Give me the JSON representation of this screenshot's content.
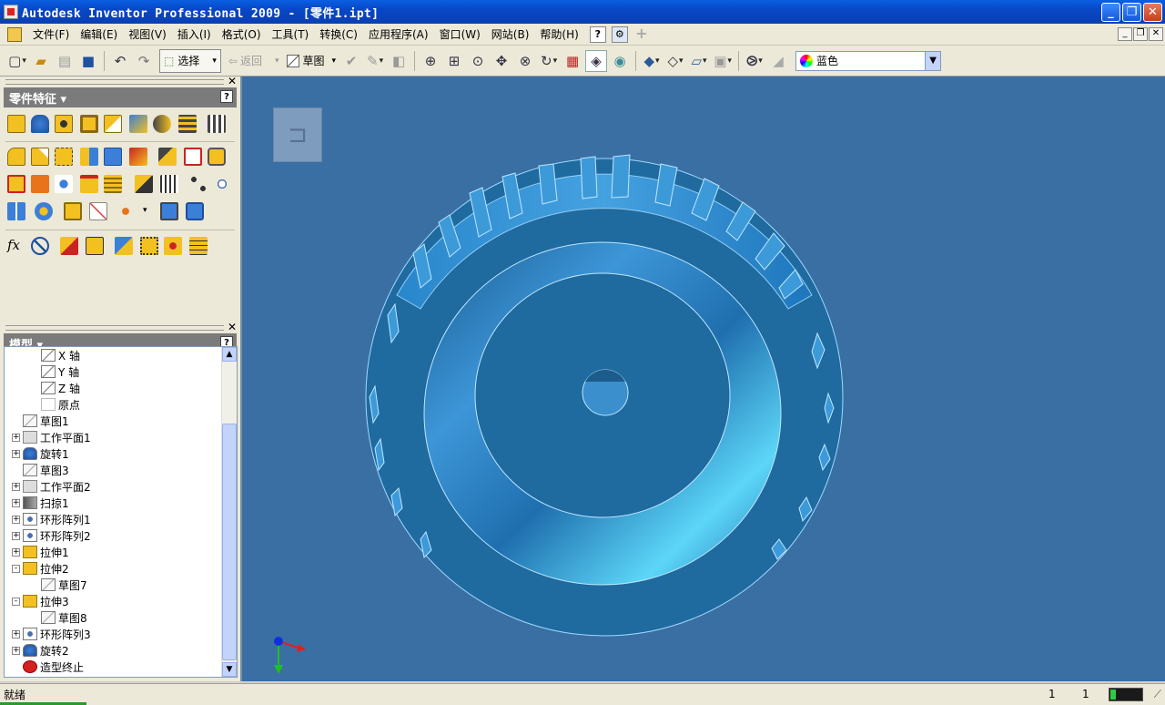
{
  "window": {
    "title": "Autodesk Inventor Professional 2009 - [零件1.ipt]",
    "minimize": "_",
    "restore": "❐",
    "close": "✕"
  },
  "menu": {
    "items": [
      "文件(F)",
      "编辑(E)",
      "视图(V)",
      "插入(I)",
      "格式(O)",
      "工具(T)",
      "转换(C)",
      "应用程序(A)",
      "窗口(W)",
      "网站(B)",
      "帮助(H)"
    ],
    "help_icon": "?"
  },
  "toolbar": {
    "select_label": "选择",
    "back_label": "返回",
    "sketch_label": "草图",
    "color_value": "蓝色"
  },
  "feature_panel": {
    "title": "零件特征 ▾",
    "help": "?",
    "close": "✕",
    "fx_label": "fx"
  },
  "model_panel": {
    "title": "模型 ▾",
    "help": "?",
    "close": "✕",
    "tree": [
      {
        "label": "X 轴",
        "icon": "axis",
        "indent": 2,
        "expander": ""
      },
      {
        "label": "Y 轴",
        "icon": "axis",
        "indent": 2,
        "expander": ""
      },
      {
        "label": "Z 轴",
        "icon": "axis",
        "indent": 2,
        "expander": ""
      },
      {
        "label": "原点",
        "icon": "point",
        "indent": 2,
        "expander": ""
      },
      {
        "label": "草图1",
        "icon": "sketch",
        "indent": 1,
        "expander": ""
      },
      {
        "label": "工作平面1",
        "icon": "plane",
        "indent": 1,
        "expander": "+"
      },
      {
        "label": "旋转1",
        "icon": "revolve",
        "indent": 1,
        "expander": "+"
      },
      {
        "label": "草图3",
        "icon": "sketch",
        "indent": 1,
        "expander": ""
      },
      {
        "label": "工作平面2",
        "icon": "plane",
        "indent": 1,
        "expander": "+"
      },
      {
        "label": "扫掠1",
        "icon": "sweep",
        "indent": 1,
        "expander": "+"
      },
      {
        "label": "环形阵列1",
        "icon": "pattern",
        "indent": 1,
        "expander": "+"
      },
      {
        "label": "环形阵列2",
        "icon": "pattern",
        "indent": 1,
        "expander": "+"
      },
      {
        "label": "拉伸1",
        "icon": "extrude",
        "indent": 1,
        "expander": "+"
      },
      {
        "label": "拉伸2",
        "icon": "extrude",
        "indent": 1,
        "expander": "-"
      },
      {
        "label": "草图7",
        "icon": "sketch",
        "indent": 2,
        "expander": ""
      },
      {
        "label": "拉伸3",
        "icon": "extrude",
        "indent": 1,
        "expander": "-"
      },
      {
        "label": "草图8",
        "icon": "sketch",
        "indent": 2,
        "expander": ""
      },
      {
        "label": "环形阵列3",
        "icon": "pattern",
        "indent": 1,
        "expander": "+"
      },
      {
        "label": "旋转2",
        "icon": "revolve",
        "indent": 1,
        "expander": "+"
      },
      {
        "label": "造型终止",
        "icon": "eop",
        "indent": 1,
        "expander": ""
      }
    ]
  },
  "viewport": {
    "background": "#3a6fa3",
    "part_color": "#1f6fae"
  },
  "status": {
    "message": "就绪",
    "count1": "1",
    "count2": "1"
  }
}
